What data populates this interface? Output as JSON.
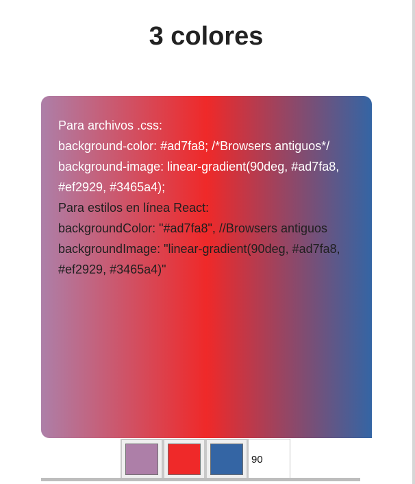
{
  "page": {
    "title": "3 colores"
  },
  "gradient": {
    "angle_deg": 90,
    "fallback_color": "#ad7fa8",
    "stops": [
      "#ad7fa8",
      "#ef2929",
      "#3465a4"
    ]
  },
  "code": {
    "css_lines": [
      "Para archivos .css:",
      "background-color: #ad7fa8; /*Browsers antiguos*/",
      "background-image: linear-gradient(90deg, #ad7fa8, #ef2929, #3465a4);"
    ],
    "react_lines": [
      "Para estilos en línea React:",
      "backgroundColor: \"#ad7fa8\", //Browsers antiguos",
      "backgroundImage: \"linear-gradient(90deg, #ad7fa8, #ef2929, #3465a4)\""
    ]
  },
  "controls": {
    "color_1": "#ad7fa8",
    "color_2": "#ef2929",
    "color_3": "#3465a4",
    "angle_value": "90"
  }
}
